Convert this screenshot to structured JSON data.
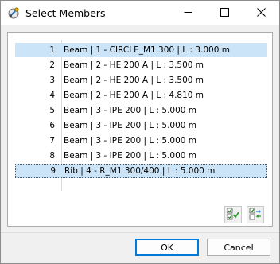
{
  "window": {
    "title": "Select Members",
    "icon": "select-members-app-icon",
    "controls": [
      "minimize-icon",
      "maximize-icon",
      "close-icon"
    ]
  },
  "members": [
    {
      "number": "1",
      "label": "Beam | 1 - CIRCLE_M1 300 | L : 3.000 m",
      "selected": true
    },
    {
      "number": "2",
      "label": "Beam | 2 - HE 200 A | L : 3.500 m",
      "selected": false
    },
    {
      "number": "3",
      "label": "Beam | 2 - HE 200 A | L : 3.500 m",
      "selected": false
    },
    {
      "number": "4",
      "label": "Beam | 2 - HE 200 A | L : 4.810 m",
      "selected": false
    },
    {
      "number": "5",
      "label": "Beam | 3 - IPE 200 | L : 5.000 m",
      "selected": false
    },
    {
      "number": "6",
      "label": "Beam | 3 - IPE 200 | L : 5.000 m",
      "selected": false
    },
    {
      "number": "7",
      "label": "Beam | 3 - IPE 200 | L : 5.000 m",
      "selected": false
    },
    {
      "number": "8",
      "label": "Beam | 3 - IPE 200 | L : 5.000 m",
      "selected": false
    },
    {
      "number": "9",
      "label": "Rib | 4 - R_M1 300/400 | L : 5.000 m",
      "selected": true
    }
  ],
  "toolbar": {
    "select_all_icon": "select-all-icon",
    "invert_selection_icon": "invert-selection-icon"
  },
  "buttons": {
    "ok": "OK",
    "cancel": "Cancel"
  },
  "colors": {
    "selection": "#cce4f7",
    "focus_border": "#1a5fa8",
    "accent": "#0078d7"
  }
}
